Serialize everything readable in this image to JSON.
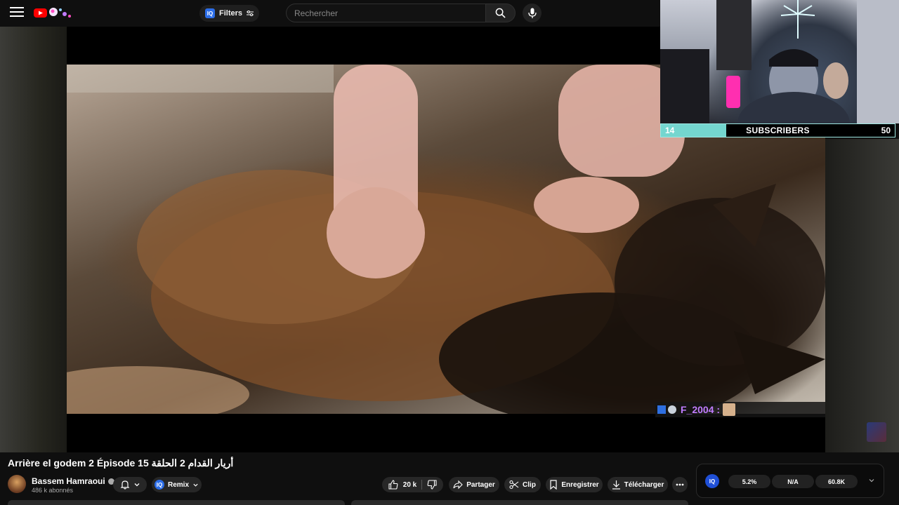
{
  "header": {
    "filters_label": "Filters",
    "iq_label": "IQ",
    "search_placeholder": "Rechercher"
  },
  "stream_overlay": {
    "subscriber_goal": {
      "current": "14",
      "label": "SUBSCRIBERS",
      "goal": "50",
      "progress_fraction": 0.28
    },
    "chat_username": "F_2004 :"
  },
  "video": {
    "title": "Arrière el godem 2 Épisode 15 أريار القدام 2 الحلقة",
    "channel_name": "Bassem Hamraoui",
    "subscribers": "486 k abonnés"
  },
  "actions": {
    "remix_label": "Remix",
    "likes": "20 k",
    "share_label": "Partager",
    "clip_label": "Clip",
    "save_label": "Enregistrer",
    "download_label": "Télécharger"
  },
  "stats": {
    "iq_label": "IQ",
    "values": [
      "5.2%",
      "N/A",
      "60.8K"
    ]
  },
  "colors": {
    "youtube_red": "#ff0000",
    "goal_fill": "#74d6cf",
    "chat_name": "#c07cff",
    "iq_blue": "#1f4fd6"
  }
}
